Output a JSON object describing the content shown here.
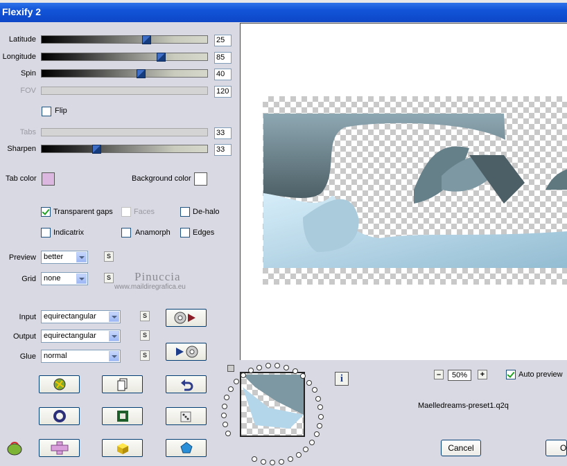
{
  "window": {
    "title": "Flexify 2"
  },
  "sliders": [
    {
      "label": "Latitude",
      "value": "25",
      "fraction": 0.63,
      "enabled": true
    },
    {
      "label": "Longitude",
      "value": "85",
      "fraction": 0.72,
      "enabled": true
    },
    {
      "label": "Spin",
      "value": "40",
      "fraction": 0.6,
      "enabled": true
    },
    {
      "label": "FOV",
      "value": "120",
      "fraction": null,
      "enabled": false
    },
    {
      "label": "Tabs",
      "value": "33",
      "fraction": null,
      "enabled": false
    },
    {
      "label": "Sharpen",
      "value": "33",
      "fraction": 0.33,
      "enabled": true
    }
  ],
  "flip": {
    "label": "Flip",
    "checked": false
  },
  "colors": {
    "tab_label": "Tab color",
    "tab_color": "#dcb8e0",
    "bg_label": "Background color",
    "bg_color": "#ffffff"
  },
  "options": {
    "transparent_gaps": {
      "label": "Transparent gaps",
      "checked": true
    },
    "faces": {
      "label": "Faces",
      "checked": false
    },
    "dehalo": {
      "label": "De-halo",
      "checked": false
    },
    "indicatrix": {
      "label": "Indicatrix",
      "checked": false
    },
    "anamorph": {
      "label": "Anamorph",
      "checked": false
    },
    "edges": {
      "label": "Edges",
      "checked": false
    }
  },
  "dropdowns": {
    "preview": {
      "label": "Preview",
      "value": "better"
    },
    "grid": {
      "label": "Grid",
      "value": "none"
    },
    "input": {
      "label": "Input",
      "value": "equirectangular"
    },
    "output": {
      "label": "Output",
      "value": "equirectangular"
    },
    "glue": {
      "label": "Glue",
      "value": "normal"
    }
  },
  "small_button_label": "S",
  "watermark": {
    "line1": "Pinuccia",
    "line2": "www.maildiregrafica.eu"
  },
  "zoom": {
    "minus": "–",
    "value": "50%",
    "plus": "+"
  },
  "auto_preview": {
    "label": "Auto preview",
    "checked": true
  },
  "preset_name": "Maelledreams-preset1.q2q",
  "info_icon": "i",
  "buttons": {
    "cancel": "Cancel",
    "ok": "OK"
  },
  "icons": [
    "random-icon",
    "copy-icon",
    "undo-icon",
    "ring-icon",
    "square-frame-icon",
    "dice-icon",
    "cross-icon",
    "cube-icon",
    "pentagon-icon"
  ],
  "palette": {
    "title_bar": "#1254d8",
    "dialog_bg": "#d9d9e3",
    "shape_light": "#b4d6ea",
    "shape_dark": "#4d5f66"
  }
}
